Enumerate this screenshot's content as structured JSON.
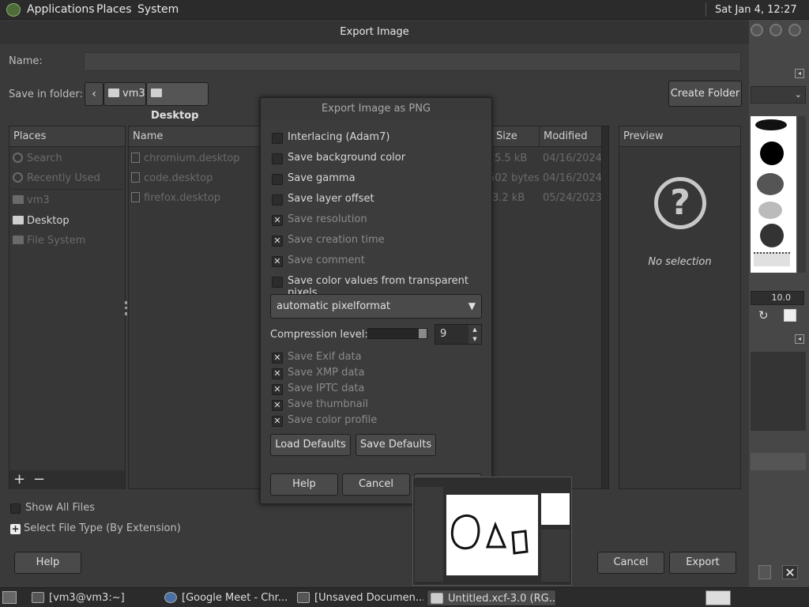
{
  "topbar": {
    "apps": "Applications",
    "places": "Places",
    "system": "System",
    "clock": "Sat Jan  4, 12:27 PM"
  },
  "dialog": {
    "title": "Export Image",
    "name_label": "Name:",
    "name_value": "",
    "save_in_label": "Save in folder:",
    "crumbs": [
      "vm3",
      "Desktop"
    ],
    "create_folder": "Create Folder",
    "places_header": "Places",
    "places": [
      "Search",
      "Recently Used",
      "vm3",
      "Desktop",
      "File System"
    ],
    "columns": {
      "name": "Name",
      "size": "Size",
      "modified": "Modified"
    },
    "files": [
      {
        "name": "chromium.desktop",
        "size": "5.5 kB",
        "modified": "04/16/2024"
      },
      {
        "name": "code.desktop",
        "size": "502 bytes",
        "modified": "04/16/2024"
      },
      {
        "name": "firefox.desktop",
        "size": "3.2 kB",
        "modified": "05/24/2023"
      }
    ],
    "preview_header": "Preview",
    "no_selection": "No selection",
    "show_all": "Show All Files",
    "select_type": "Select File Type (By Extension)",
    "help": "Help",
    "cancel": "Cancel",
    "export": "Export"
  },
  "png": {
    "title": "Export Image as PNG",
    "options": [
      {
        "label": "Interlacing (Adam7)",
        "checked": false
      },
      {
        "label": "Save background color",
        "checked": false
      },
      {
        "label": "Save gamma",
        "checked": false
      },
      {
        "label": "Save layer offset",
        "checked": false
      },
      {
        "label": "Save resolution",
        "checked": true
      },
      {
        "label": "Save creation time",
        "checked": true
      },
      {
        "label": "Save comment",
        "checked": true
      },
      {
        "label": "Save color values from transparent pixels",
        "checked": false
      }
    ],
    "pixelformat": "automatic pixelformat",
    "compression_label": "Compression level:",
    "compression_value": "9",
    "compression_fraction": 1.0,
    "meta": [
      {
        "label": "Save Exif data",
        "checked": true
      },
      {
        "label": "Save XMP data",
        "checked": true
      },
      {
        "label": "Save IPTC data",
        "checked": true
      },
      {
        "label": "Save thumbnail",
        "checked": true
      },
      {
        "label": "Save color profile",
        "checked": true
      }
    ],
    "load_defaults": "Load Defaults",
    "save_defaults": "Save Defaults",
    "help": "Help",
    "cancel": "Cancel"
  },
  "gimp": {
    "brush_size": "10.0"
  },
  "taskbar": [
    "[vm3@vm3:~]",
    "[Google Meet - Chr...",
    "[Unsaved Documen...",
    "Untitled.xcf-3.0 (RG..."
  ]
}
